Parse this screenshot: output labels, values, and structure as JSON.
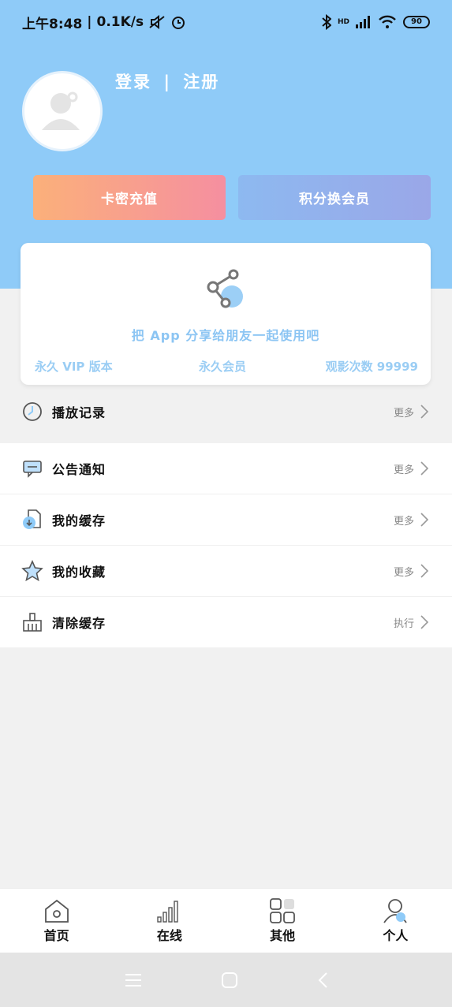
{
  "status_bar": {
    "time": "上午8:48",
    "net_speed": "0.1K/s",
    "network": "HD",
    "battery": "90"
  },
  "profile": {
    "login_text": "登录",
    "separator": "|",
    "register_text": "注册"
  },
  "actions": {
    "recharge": "卡密充值",
    "exchange": "积分换会员"
  },
  "share_card": {
    "text": "把 App 分享给朋友一起使用吧",
    "stats": {
      "version": "永久 VIP 版本",
      "membership": "永久会员",
      "views": "观影次数 99999"
    }
  },
  "menu": [
    {
      "label": "播放记录",
      "action": "更多",
      "icon": "clock-icon"
    },
    {
      "label": "公告通知",
      "action": "更多",
      "icon": "message-icon"
    },
    {
      "label": "我的缓存",
      "action": "更多",
      "icon": "download-file-icon"
    },
    {
      "label": "我的收藏",
      "action": "更多",
      "icon": "star-icon"
    },
    {
      "label": "清除缓存",
      "action": "执行",
      "icon": "broom-icon"
    }
  ],
  "tabbar": [
    {
      "label": "首页",
      "icon": "home-icon"
    },
    {
      "label": "在线",
      "icon": "signal-bars-icon"
    },
    {
      "label": "其他",
      "icon": "grid-icon"
    },
    {
      "label": "个人",
      "icon": "person-icon"
    }
  ],
  "colors": {
    "hero": "#8fcbf8",
    "accent_text": "#8cc5f3"
  }
}
